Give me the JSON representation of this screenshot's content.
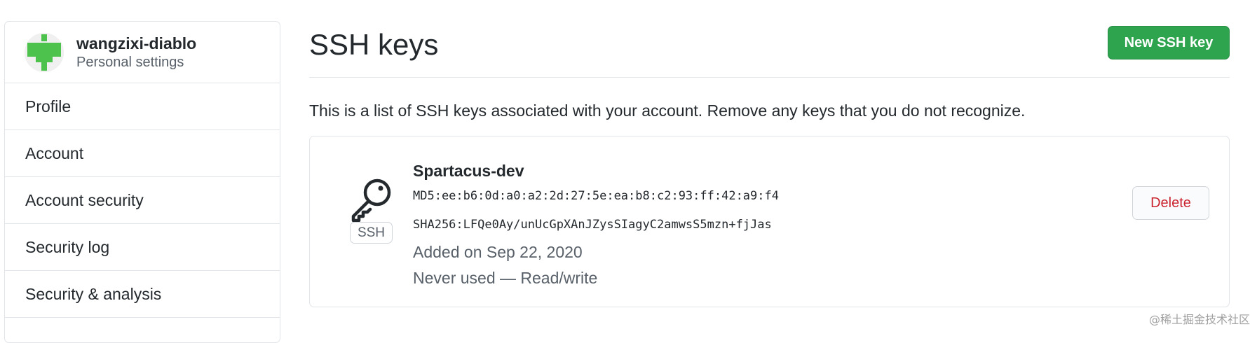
{
  "sidebar": {
    "username": "wangzixi-diablo",
    "subtitle": "Personal settings",
    "items": [
      {
        "label": "Profile"
      },
      {
        "label": "Account"
      },
      {
        "label": "Account security"
      },
      {
        "label": "Security log"
      },
      {
        "label": "Security & analysis"
      }
    ]
  },
  "main": {
    "title": "SSH keys",
    "new_key_button": "New SSH key",
    "description": "This is a list of SSH keys associated with your account. Remove any keys that you do not recognize.",
    "keys": [
      {
        "badge": "SSH",
        "icon": "key-icon",
        "title": "Spartacus-dev",
        "md5": "MD5:ee:b6:0d:a0:a2:2d:27:5e:ea:b8:c2:93:ff:42:a9:f4",
        "sha256": "SHA256:LFQe0Ay/unUcGpXAnJZysSIagyC2amwsS5mzn+fjJas",
        "added": "Added on Sep 22, 2020",
        "usage": "Never used — Read/write",
        "delete_label": "Delete"
      }
    ]
  },
  "watermark": "@稀土掘金技术社区",
  "colors": {
    "primary_button": "#2ea44f",
    "danger_text": "#cb2431",
    "border": "#e1e4e8",
    "muted_text": "#586069"
  }
}
